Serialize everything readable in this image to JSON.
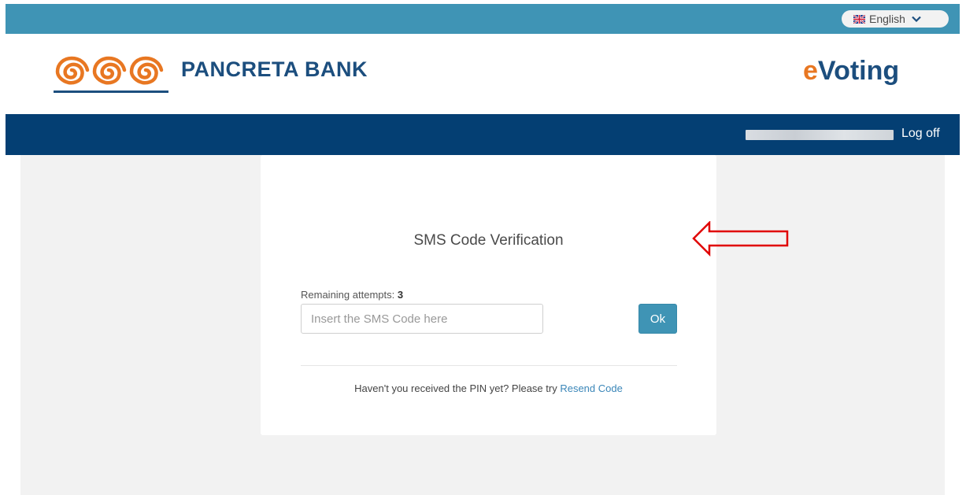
{
  "language": {
    "label": "English",
    "icon": "uk-flag-icon"
  },
  "brand": {
    "name": "PANCRETA BANK",
    "logo": "spiral-logo",
    "app_prefix": "e",
    "app_suffix": "Voting",
    "logo_color": "#e87722",
    "brand_color": "#1c4e7e"
  },
  "nav": {
    "logoff_label": "Log off"
  },
  "verification": {
    "title": "SMS Code Verification",
    "attempts_label": "Remaining attempts: ",
    "attempts_count": "3",
    "input_placeholder": "Insert the SMS Code here",
    "input_value": "",
    "ok_label": "Ok",
    "resend_prompt": "Haven't you received the PIN yet? Please try ",
    "resend_link": "Resend Code"
  },
  "colors": {
    "topbar": "#3f94b5",
    "navbar": "#043f73",
    "button": "#3f94b5",
    "annotation_arrow": "#e00000"
  }
}
